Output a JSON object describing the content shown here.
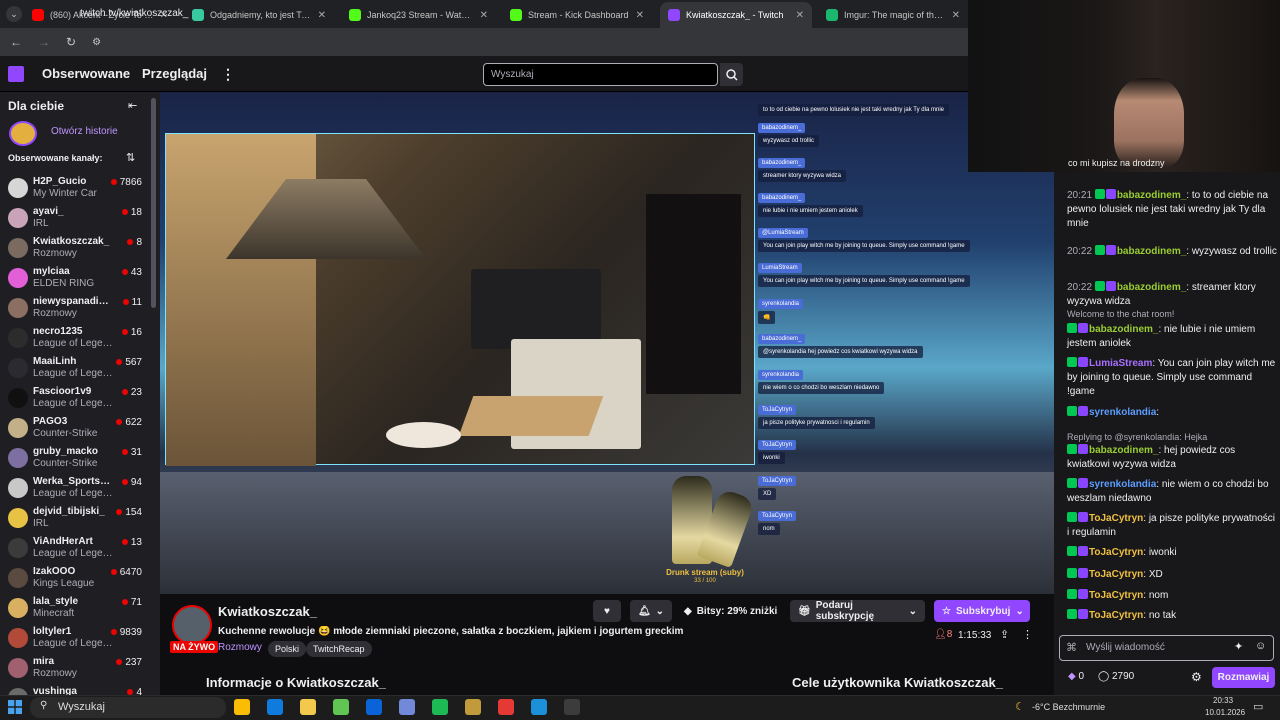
{
  "browser": {
    "tabs": [
      {
        "label": "(860) Akcent - Życie To Są Chwile",
        "color": "#ff0000"
      },
      {
        "label": "Odgadniemy, kto jest Twoją sekretną",
        "color": "#38c9a0"
      },
      {
        "label": "Jankoq23 Stream - Watch Live",
        "color": "#53fc18"
      },
      {
        "label": "Stream - Kick Dashboard",
        "color": "#53fc18"
      },
      {
        "label": "Kwiatkoszczak_ - Twitch",
        "color": "#9147ff"
      },
      {
        "label": "Imgur: The magic of the Internet",
        "color": "#1bb76e"
      }
    ],
    "url": "twitch.tv/kwiatkoszczak_"
  },
  "topnav": {
    "following": "Obserwowane",
    "browse": "Przeglądaj",
    "search_placeholder": "Wyszukaj"
  },
  "sidebar": {
    "header": "Dla ciebie",
    "stories": "Otwórz historie",
    "followed_label": "Obserwowane kanały:",
    "channels": [
      {
        "name": "H2P_Gucio",
        "game": "My Winter Car",
        "viewers": "7866",
        "color": "#d6d6d6"
      },
      {
        "name": "ayavi_",
        "game": "IRL",
        "viewers": "18",
        "color": "#c9a3b8"
      },
      {
        "name": "Kwiatkoszczak_",
        "game": "Rozmowy",
        "viewers": "8",
        "color": "#7b6a60"
      },
      {
        "name": "mylciaa",
        "game": "ELDEN RING",
        "viewers": "43",
        "color": "#e25fd8"
      },
      {
        "name": "niewyspanadiana",
        "game": "Rozmowy",
        "viewers": "11",
        "color": "#8a6f62"
      },
      {
        "name": "necro1235",
        "game": "League of Legends",
        "viewers": "16",
        "color": "#2c2c2c"
      },
      {
        "name": "MaaiLinh",
        "game": "League of Legends",
        "viewers": "567",
        "color": "#2a2a30"
      },
      {
        "name": "Fascioor1v9",
        "game": "League of Legends",
        "viewers": "23",
        "color": "#101010"
      },
      {
        "name": "PAGO3",
        "game": "Counter-Strike",
        "viewers": "622",
        "color": "#c3b088"
      },
      {
        "name": "gruby_macko",
        "game": "Counter-Strike",
        "viewers": "31",
        "color": "#7d6fa0"
      },
      {
        "name": "Werka_Sportsmenka",
        "game": "League of Legends",
        "viewers": "94",
        "color": "#c8c8c8"
      },
      {
        "name": "dejvid_tibijski_",
        "game": "IRL",
        "viewers": "154",
        "color": "#e7c244"
      },
      {
        "name": "ViAndHerArt",
        "game": "League of Legends",
        "viewers": "13",
        "color": "#3b3b3b"
      },
      {
        "name": "IzakOOO",
        "game": "Kings League",
        "viewers": "6470",
        "color": "#5a4a40"
      },
      {
        "name": "lala_style",
        "game": "Minecraft",
        "viewers": "71",
        "color": "#d8b060"
      },
      {
        "name": "loltyler1",
        "game": "League of Legends",
        "viewers": "9839",
        "color": "#b24a3a"
      },
      {
        "name": "mira",
        "game": "Rozmowy",
        "viewers": "237",
        "color": "#a06070"
      },
      {
        "name": "vushinga",
        "game": "",
        "viewers": "4",
        "color": "#6a6a6a"
      }
    ]
  },
  "overlay_chat": [
    {
      "user": "",
      "text": "to to od ciebie na pewno lolusiek nie jest taki wredny jak Ty dla mnie"
    },
    {
      "user": "babazodinem_",
      "text": "wyzywasz od trollic"
    },
    {
      "user": "babazodinem_",
      "text": "streamer ktory wyzywa widza"
    },
    {
      "user": "babazodinem_",
      "text": "nie lubie i nie umiem jestem aniolek"
    },
    {
      "user": "@LumiaStream",
      "text": "You can join play witch me by joining to queue. Simply use command !game"
    },
    {
      "user": "LumiaStream",
      "text": "You can join play witch me by joining to queue. Simply use command !game"
    },
    {
      "user": "syrenkolandia",
      "text": "👊"
    },
    {
      "user": "babazodinem_",
      "text": "@syrenkolandia hej powiedz cos kwiatkowi wyzywa widza"
    },
    {
      "user": "syrenkolandia",
      "text": "nie wiem o co chodzi bo weszlam niedawno"
    },
    {
      "user": "ToJaCytryn",
      "text": "ja pisze polityke prywatnosci i regulamin"
    },
    {
      "user": "ToJaCytryn",
      "text": "iwonki"
    },
    {
      "user": "ToJaCytryn",
      "text": "XD"
    },
    {
      "user": "ToJaCytryn",
      "text": "nom"
    }
  ],
  "drunk": {
    "label": "Drunk stream (suby)",
    "count": "33 / 100"
  },
  "stream": {
    "channel": "Kwiatkoszczak_",
    "title": "Kuchenne rewolucje 😆 młode ziemniaki pieczone, sałatka z boczkiem, jajkiem i jogurtem greckim",
    "category": "Rozmowy",
    "tags": [
      "Polski",
      "TwitchRecap"
    ],
    "live": "NA ŻYWO",
    "viewers": "8",
    "uptime": "1:15:33",
    "bits": "Bitsy: 29% zniżki",
    "gift": "Podaruj subskrypcję",
    "subscribe": "Subskrybuj",
    "about": "Informacje o Kwiatkoszczak_",
    "goals": "Cele użytkownika Kwiatkoszczak_"
  },
  "chat": {
    "top_partial": "co mi kupisz na drodzny",
    "messages": [
      {
        "time": "20:21",
        "user": "babazodinem_",
        "color": "#9acd32",
        "text": ": to to od ciebie na pewno lolusiek nie jest taki wredny jak Ty dla mnie"
      },
      {
        "time": "20:22",
        "user": "babazodinem_",
        "color": "#9acd32",
        "text": ": wyzywasz od trollic"
      },
      {
        "time": "20:22",
        "user": "babazodinem_",
        "color": "#9acd32",
        "text": ": streamer ktory wyzywa widza"
      },
      {
        "time": "",
        "user": "",
        "color": "#adadb8",
        "text": "Welcome to the chat room!"
      },
      {
        "time": "",
        "user": "babazodinem_",
        "color": "#9acd32",
        "text": ": nie lubie i nie umiem jestem aniolek"
      },
      {
        "time": "",
        "user": "LumiaStream",
        "color": "#a970ff",
        "text": ": You can join play witch me by joining to queue. Simply use command !game"
      },
      {
        "time": "",
        "user": "syrenkolandia",
        "color": "#5c9dff",
        "text": ":"
      },
      {
        "time": "",
        "user": "",
        "color": "#adadb8",
        "text": "Replying to @syrenkolandia: Hejka"
      },
      {
        "time": "",
        "user": "babazodinem_",
        "color": "#9acd32",
        "text": ": hej powiedz cos kwiatkowi wyzywa widza"
      },
      {
        "time": "",
        "user": "syrenkolandia",
        "color": "#5c9dff",
        "text": ": nie wiem o co chodzi bo weszlam niedawno"
      },
      {
        "time": "",
        "user": "ToJaCytryn",
        "color": "#f0c040",
        "text": ": ja pisze polityke prywatności i regulamin"
      },
      {
        "time": "",
        "user": "ToJaCytryn",
        "color": "#f0c040",
        "text": ": iwonki"
      },
      {
        "time": "",
        "user": "ToJaCytryn",
        "color": "#f0c040",
        "text": ": XD"
      },
      {
        "time": "",
        "user": "ToJaCytryn",
        "color": "#f0c040",
        "text": ": nom"
      },
      {
        "time": "",
        "user": "ToJaCytryn",
        "color": "#f0c040",
        "text": ": no tak"
      }
    ],
    "input_placeholder": "Wyślij wiadomość",
    "bits": "0",
    "points": "2790",
    "send": "Rozmawiaj"
  },
  "taskbar": {
    "search": "Wyszukaj",
    "weather": "-6°C  Bezchmurnie",
    "time": "20:33",
    "date": "10.01.2026"
  },
  "colors": {
    "twitch_purple": "#9147ff",
    "live_red": "#eb0400"
  }
}
